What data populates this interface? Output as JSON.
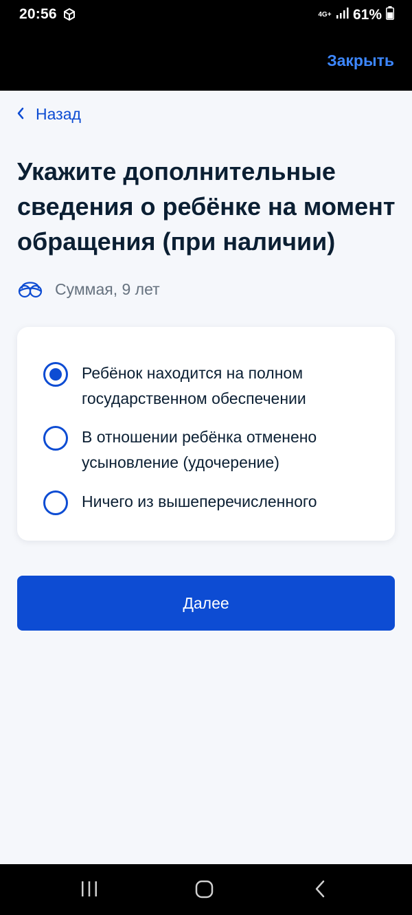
{
  "status_bar": {
    "time": "20:56",
    "network": "4G+",
    "battery": "61%"
  },
  "header": {
    "close_label": "Закрыть"
  },
  "nav": {
    "back_label": "Назад"
  },
  "page": {
    "title": "Укажите дополнительные сведения о ребёнке на момент обращения (при наличии)",
    "child_name": "Суммая, 9 лет"
  },
  "options": [
    {
      "label": "Ребёнок находится на полном государственном обеспечении",
      "checked": true
    },
    {
      "label": "В отношении ребёнка отменено усыновление (удочерение)",
      "checked": false
    },
    {
      "label": "Ничего из вышеперечисленного",
      "checked": false
    }
  ],
  "actions": {
    "next_label": "Далее"
  },
  "colors": {
    "accent": "#0d4cd3",
    "close_link": "#3d87ff",
    "title": "#0b1f33",
    "muted": "#66727f",
    "background": "#f5f7fb"
  },
  "icons": {
    "status_app": "cube-icon",
    "signal": "signal-icon",
    "battery": "battery-icon",
    "back": "chevron-left-icon",
    "child": "child-icon",
    "nav_recents": "recents-icon",
    "nav_home": "home-icon",
    "nav_back": "back-icon"
  }
}
